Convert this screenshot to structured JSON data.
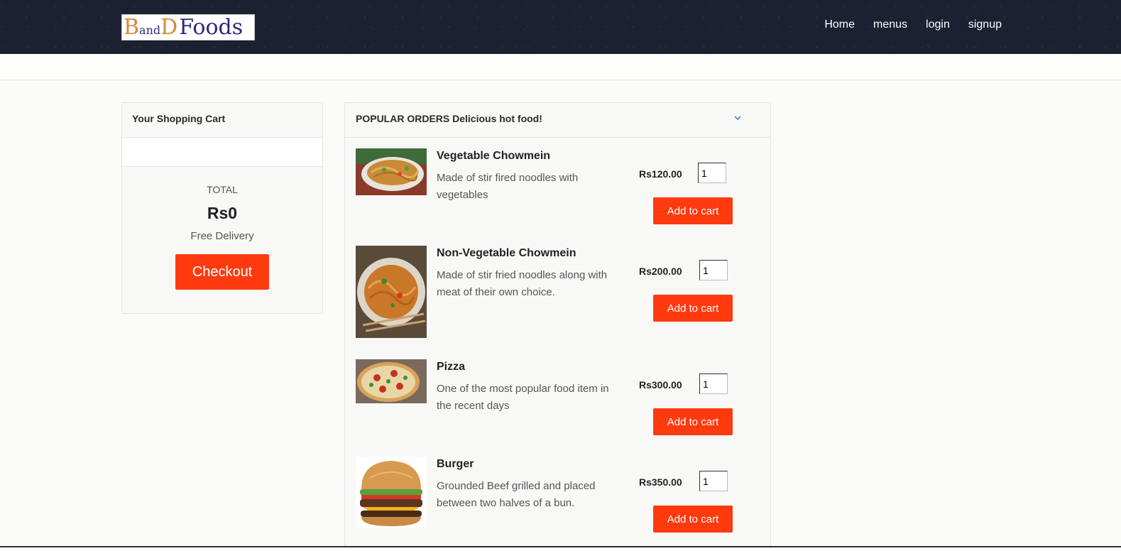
{
  "header": {
    "logo": {
      "b": "B",
      "and": "and",
      "d": "D",
      "foods": "Foods"
    },
    "nav": [
      "Home",
      "menus",
      "login",
      "signup"
    ]
  },
  "cart": {
    "title": "Your Shopping Cart",
    "total_label": "TOTAL",
    "total_value": "Rs0",
    "delivery": "Free Delivery",
    "checkout_label": "Checkout"
  },
  "orders": {
    "title": "POPULAR ORDERS Delicious hot food!",
    "items": [
      {
        "name": "Vegetable Chowmein",
        "desc": "Made of stir fired noodles with vegetables",
        "price": "Rs120.00",
        "qty": "1",
        "add_label": "Add to cart"
      },
      {
        "name": "Non-Vegetable Chowmein",
        "desc": "Made of stir fried noodles along with meat of their own choice.",
        "price": "Rs200.00",
        "qty": "1",
        "add_label": "Add to cart"
      },
      {
        "name": "Pizza",
        "desc": "One of the most popular food item in the recent days",
        "price": "Rs300.00",
        "qty": "1",
        "add_label": "Add to cart"
      },
      {
        "name": "Burger",
        "desc": "Grounded Beef grilled and placed between two halves of a bun.",
        "price": "Rs350.00",
        "qty": "1",
        "add_label": "Add to cart"
      }
    ]
  },
  "colors": {
    "accent": "#ff3a0e",
    "header_bg": "#1b2130",
    "logo_orange": "#d48a36",
    "logo_navy": "#2d2a7a"
  }
}
